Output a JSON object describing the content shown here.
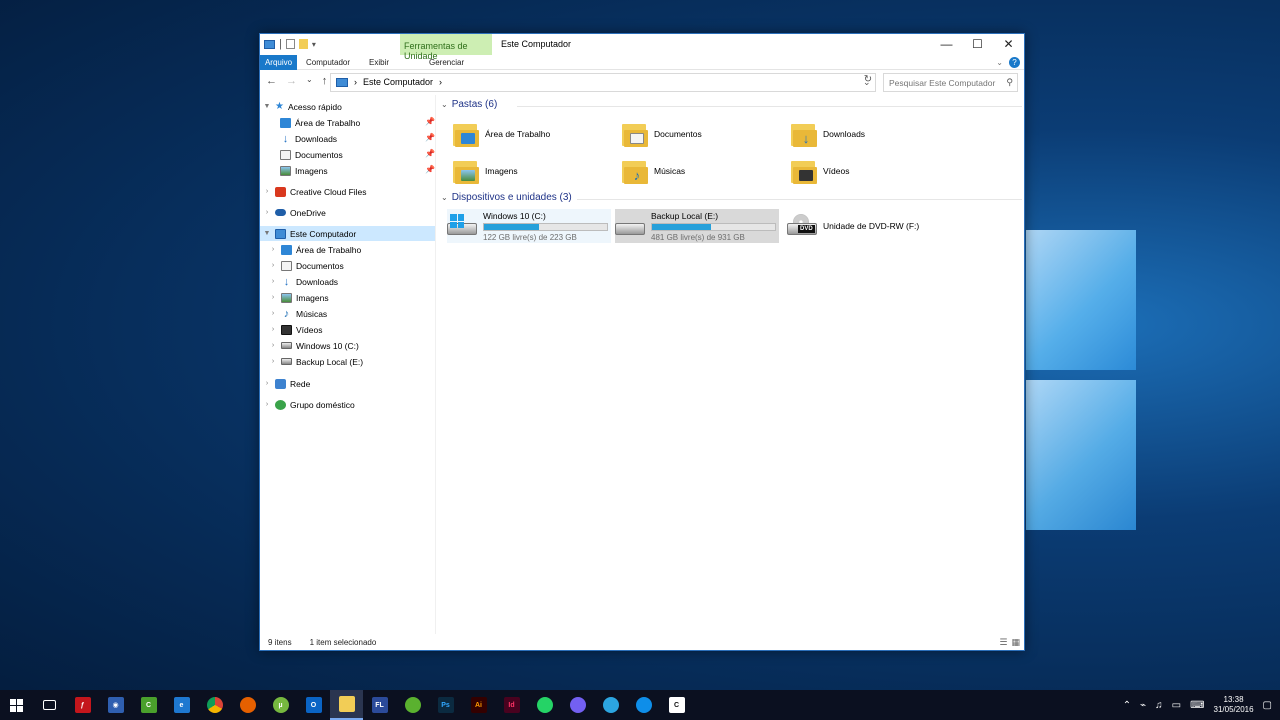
{
  "window": {
    "qat_sep": "|",
    "tool_tab": "Ferramentas de Unidade",
    "title": "Este Computador",
    "min": "—",
    "max": "☐",
    "close": "✕"
  },
  "ribbon": {
    "tabs": [
      "Arquivo",
      "Computador",
      "Exibir",
      "Gerenciar"
    ],
    "help": "?"
  },
  "address": {
    "back": "←",
    "forward": "→",
    "recent": "⌄",
    "up": "↑",
    "sep": "›",
    "path": "Este Computador",
    "dropdown": "⌄",
    "refresh": "↻",
    "search_placeholder": "Pesquisar Este Computador"
  },
  "nav": {
    "quick_access": "Acesso rápido",
    "quick": [
      "Área de Trabalho",
      "Downloads",
      "Documentos",
      "Imagens"
    ],
    "creative_cloud": "Creative Cloud Files",
    "onedrive": "OneDrive",
    "this_pc": "Este Computador",
    "pc_items": [
      "Área de Trabalho",
      "Documentos",
      "Downloads",
      "Imagens",
      "Músicas",
      "Vídeos",
      "Windows 10 (C:)",
      "Backup Local (E:)"
    ],
    "network": "Rede",
    "homegroup": "Grupo doméstico"
  },
  "content": {
    "folders_header": "Pastas (6)",
    "folders": [
      "Área de Trabalho",
      "Documentos",
      "Downloads",
      "Imagens",
      "Músicas",
      "Vídeos"
    ],
    "devices_header": "Dispositivos e unidades (3)",
    "drives": [
      {
        "name": "Windows 10 (C:)",
        "free": "122 GB livre(s) de 223 GB",
        "used_fraction": 0.45
      },
      {
        "name": "Backup Local (E:)",
        "free": "481 GB livre(s) de 931 GB",
        "used_fraction": 0.48
      },
      {
        "name": "Unidade de DVD-RW (F:)"
      }
    ]
  },
  "status": {
    "count": "9 itens",
    "selected": "1 item selecionado"
  },
  "taskbar": {
    "clock_time": "13:38",
    "clock_date": "31/05/2016",
    "apps": [
      "start-icon",
      "task-view-icon",
      "flash-icon",
      "media-icon",
      "camtasia-icon",
      "edge-icon",
      "chrome-icon",
      "firefox-icon",
      "utorrent-icon",
      "outlook-icon",
      "file-explorer-icon",
      "fl-studio-icon",
      "corel-icon",
      "photoshop-icon",
      "illustrator-icon",
      "indesign-icon",
      "whatsapp-icon",
      "viber-icon",
      "telegram-icon",
      "teamviewer-icon",
      "camtasia-recorder-icon"
    ]
  },
  "colors": {
    "accent": "#1979ca",
    "selection": "#cce8ff",
    "drive_bar": "#26a0da",
    "tool_tab_bg": "#cdeeb3"
  }
}
